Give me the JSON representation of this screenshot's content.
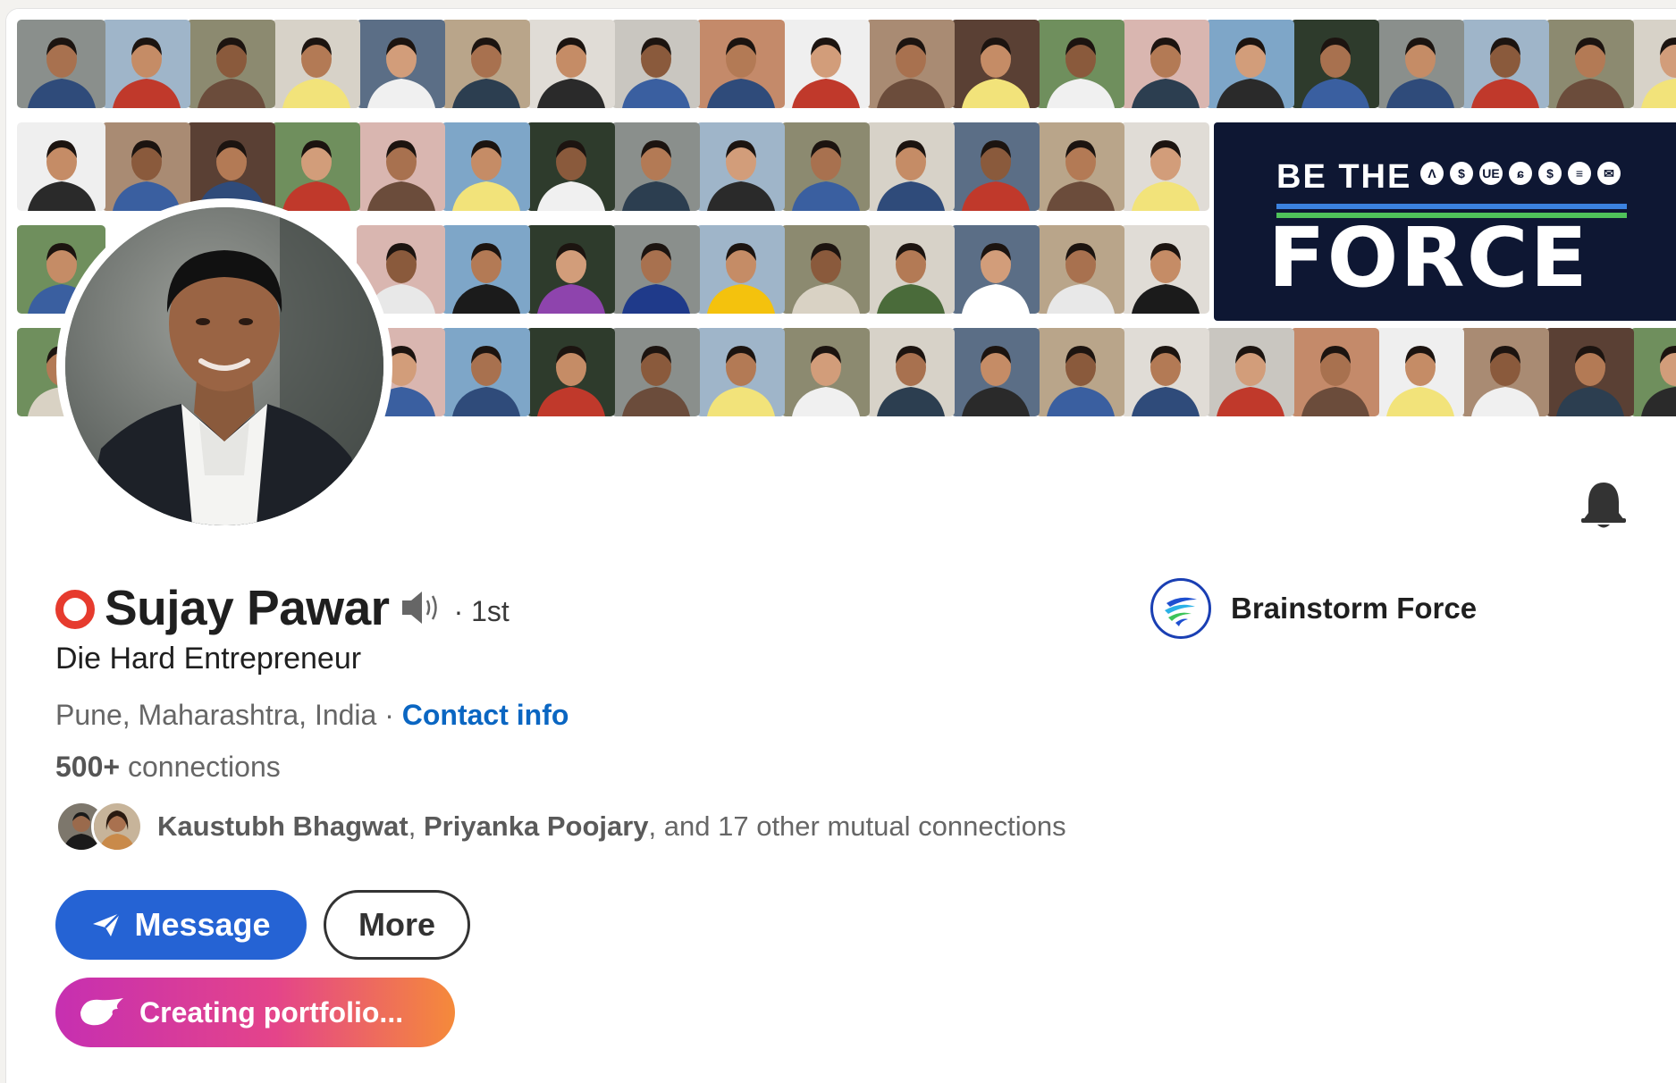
{
  "profile": {
    "name": "Sujay Pawar",
    "degree": "· 1st",
    "headline": "Die Hard Entrepreneur",
    "location": "Pune, Maharashtra, India",
    "location_separator": " · ",
    "contact_info_label": "Contact info",
    "connections_count": "500+",
    "connections_label": " connections",
    "open_to_work_ring_color": "#e63b2e",
    "avatar_icon": "profile-photo"
  },
  "mutual": {
    "person1": "Kaustubh Bhagwat",
    "separator": ", ",
    "person2": "Priyanka Poojary",
    "rest": ", and 17 other mutual connections"
  },
  "company": {
    "name": "Brainstorm Force",
    "logo_icon": "brainstorm-force-logo"
  },
  "actions": {
    "message_label": "Message",
    "more_label": "More",
    "portfolio_label": "Creating portfolio..."
  },
  "banner": {
    "line1": "BE THE",
    "line2": "FORCE",
    "brand_icons": [
      "Λ",
      "$",
      "UE",
      "ɕ",
      "$",
      "≡",
      "✉"
    ],
    "tile_count": 70
  },
  "colors": {
    "link": "#0a66c2",
    "primary_button": "#2563d4",
    "force_panel": "#0e1733",
    "force_stripe_blue": "#3b82e0",
    "force_stripe_green": "#4fc25a"
  },
  "icons": {
    "bell": "bell-icon",
    "speaker": "speaker-icon",
    "message": "send-icon",
    "portfolio": "swoosh-icon"
  }
}
